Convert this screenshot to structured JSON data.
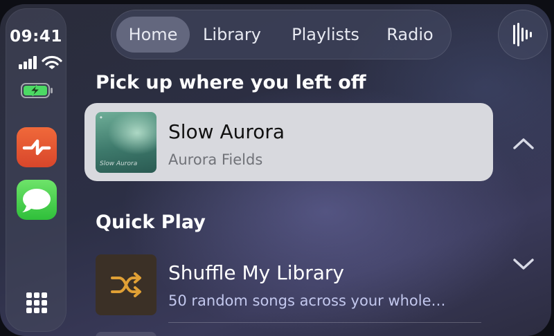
{
  "status": {
    "time": "09:41",
    "signal_icon": "signal-bars-icon",
    "wifi_icon": "wifi-icon",
    "battery_icon": "battery-charging-icon",
    "battery_color": "#4cd964"
  },
  "dock": {
    "apps": [
      {
        "name": "Now Playing",
        "icon": "now-playing-icon",
        "color": "#e8572f"
      },
      {
        "name": "Messages",
        "icon": "messages-icon",
        "color": "#43cf4b"
      }
    ],
    "grid_icon": "app-grid-icon"
  },
  "tabs": [
    {
      "label": "Home",
      "active": true
    },
    {
      "label": "Library",
      "active": false
    },
    {
      "label": "Playlists",
      "active": false
    },
    {
      "label": "Radio",
      "active": false
    }
  ],
  "siri_icon": "voice-waveform-icon",
  "resume": {
    "title": "Pick up where you left off",
    "item": {
      "title": "Slow Aurora",
      "artist": "Aurora Fields",
      "cover_text": "Slow Aurora"
    }
  },
  "quick_play": {
    "title": "Quick Play",
    "item": {
      "title": "Shuffle My Library",
      "subtitle": "50 random songs across your whole…",
      "icon": "shuffle-icon",
      "icon_color": "#e0a035"
    }
  }
}
